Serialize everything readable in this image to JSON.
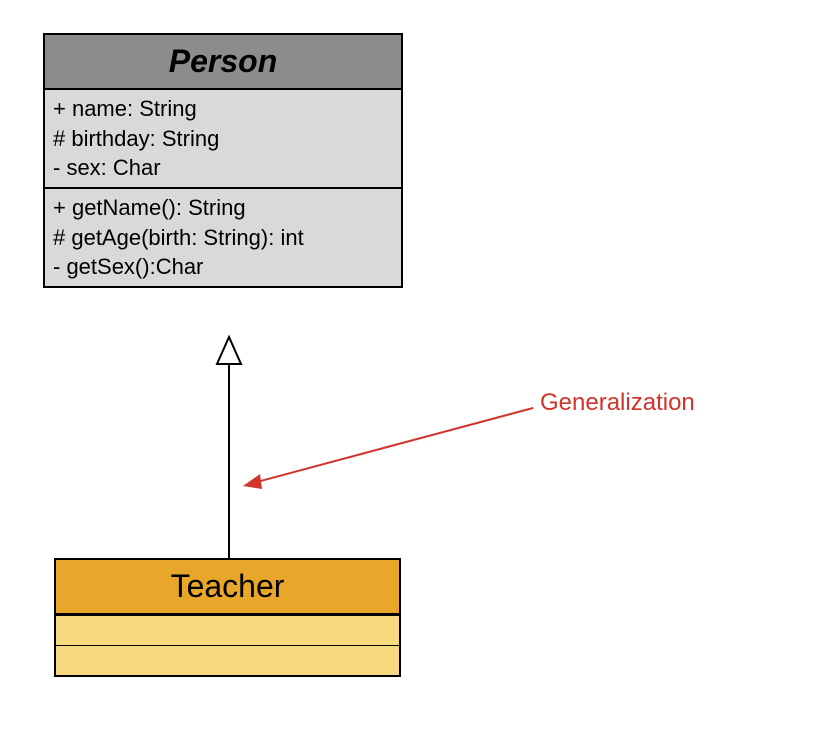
{
  "diagram": {
    "type": "uml-class-diagram",
    "classes": {
      "person": {
        "name": "Person",
        "abstract": true,
        "attributes": [
          "+ name: String",
          "# birthday: String",
          "-  sex: Char"
        ],
        "operations": [
          "+ getName(): String",
          "# getAge(birth: String): int",
          "-  getSex():Char"
        ]
      },
      "teacher": {
        "name": "Teacher",
        "attributes": [],
        "operations": []
      }
    },
    "relationship": {
      "type": "generalization",
      "from": "Teacher",
      "to": "Person"
    },
    "annotation": "Generalization"
  }
}
